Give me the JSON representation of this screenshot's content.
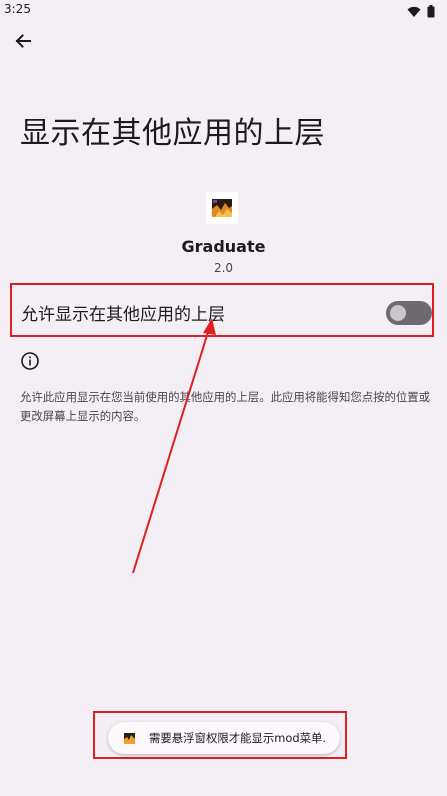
{
  "status_bar": {
    "time": "3:25",
    "icons": [
      "wifi-icon",
      "battery-icon"
    ]
  },
  "header": {
    "back_icon": "arrow-back-icon",
    "title": "显示在其他应用的上层"
  },
  "app": {
    "name": "Graduate",
    "version": "2.0"
  },
  "setting": {
    "label": "允许显示在其他应用的上层",
    "enabled": false
  },
  "info": {
    "icon": "info-icon",
    "description": "允许此应用显示在您当前使用的其他应用的上层。此应用将能得知您点按的位置或更改屏幕上显示的内容。"
  },
  "toast": {
    "text": "需要悬浮窗权限才能显示mod菜单."
  },
  "colors": {
    "background": "#f3eff4",
    "annotation": "#e02020",
    "switch_track": "#6e6a72",
    "switch_thumb": "#c9c5ca"
  }
}
